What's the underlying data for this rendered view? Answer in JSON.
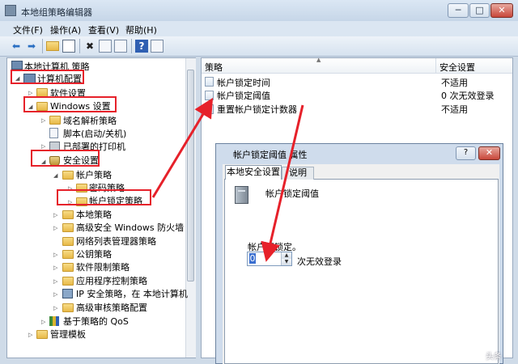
{
  "window": {
    "title": "本地组策略编辑器",
    "controls": {
      "minimize": "─",
      "maximize": "□",
      "close": "✕"
    }
  },
  "menu": [
    "文件(F)",
    "操作(A)",
    "查看(V)",
    "帮助(H)"
  ],
  "toolbar": {
    "icons": [
      "back-icon",
      "forward-icon",
      "up-folder-icon",
      "show-hide-tree-icon",
      "delete-icon",
      "properties-icon",
      "export-list-icon",
      "help-icon",
      "action-pane-icon"
    ],
    "glyphs": {
      "back": "⬅",
      "forward": "➡",
      "help": "?"
    }
  },
  "tree": {
    "root": "本地计算机 策略",
    "computer_config": "计算机配置",
    "software_settings": "软件设置",
    "windows_settings": "Windows 设置",
    "dns": "域名解析策略",
    "scripts": "脚本(启动/关机)",
    "printers": "已部署的打印机",
    "security_settings": "安全设置",
    "account_policies": "帐户策略",
    "password_policy": "密码策略",
    "lockout_policy": "帐户锁定策略",
    "local_policies": "本地策略",
    "firewall": "高级安全 Windows 防火墙",
    "network_list": "网络列表管理器策略",
    "public_key": "公钥策略",
    "software_restriction": "软件限制策略",
    "app_control": "应用程序控制策略",
    "ipsec": "IP 安全策略，在 本地计算机",
    "audit": "高级审核策略配置",
    "qos": "基于策略的 QoS",
    "admin_templates": "管理模板"
  },
  "list": {
    "col_policy": "策略",
    "col_setting": "安全设置",
    "rows": [
      {
        "name": "帐户锁定时间",
        "value": "不适用"
      },
      {
        "name": "帐户锁定阈值",
        "value": "0 次无效登录"
      },
      {
        "name": "重置帐户锁定计数器",
        "value": "不适用"
      }
    ]
  },
  "dialog": {
    "title": "帐户锁定阈值 属性",
    "help": "?",
    "close": "✕",
    "tab_local": "本地安全设置",
    "tab_desc": "说明",
    "policy_name": "帐户锁定阈值",
    "lockout_label": "帐户不锁定。",
    "threshold_value": "0",
    "unit": "次无效登录",
    "spin_up": "▲",
    "spin_down": "▼"
  },
  "annotation_color": "#e6212a",
  "watermark": "头条"
}
